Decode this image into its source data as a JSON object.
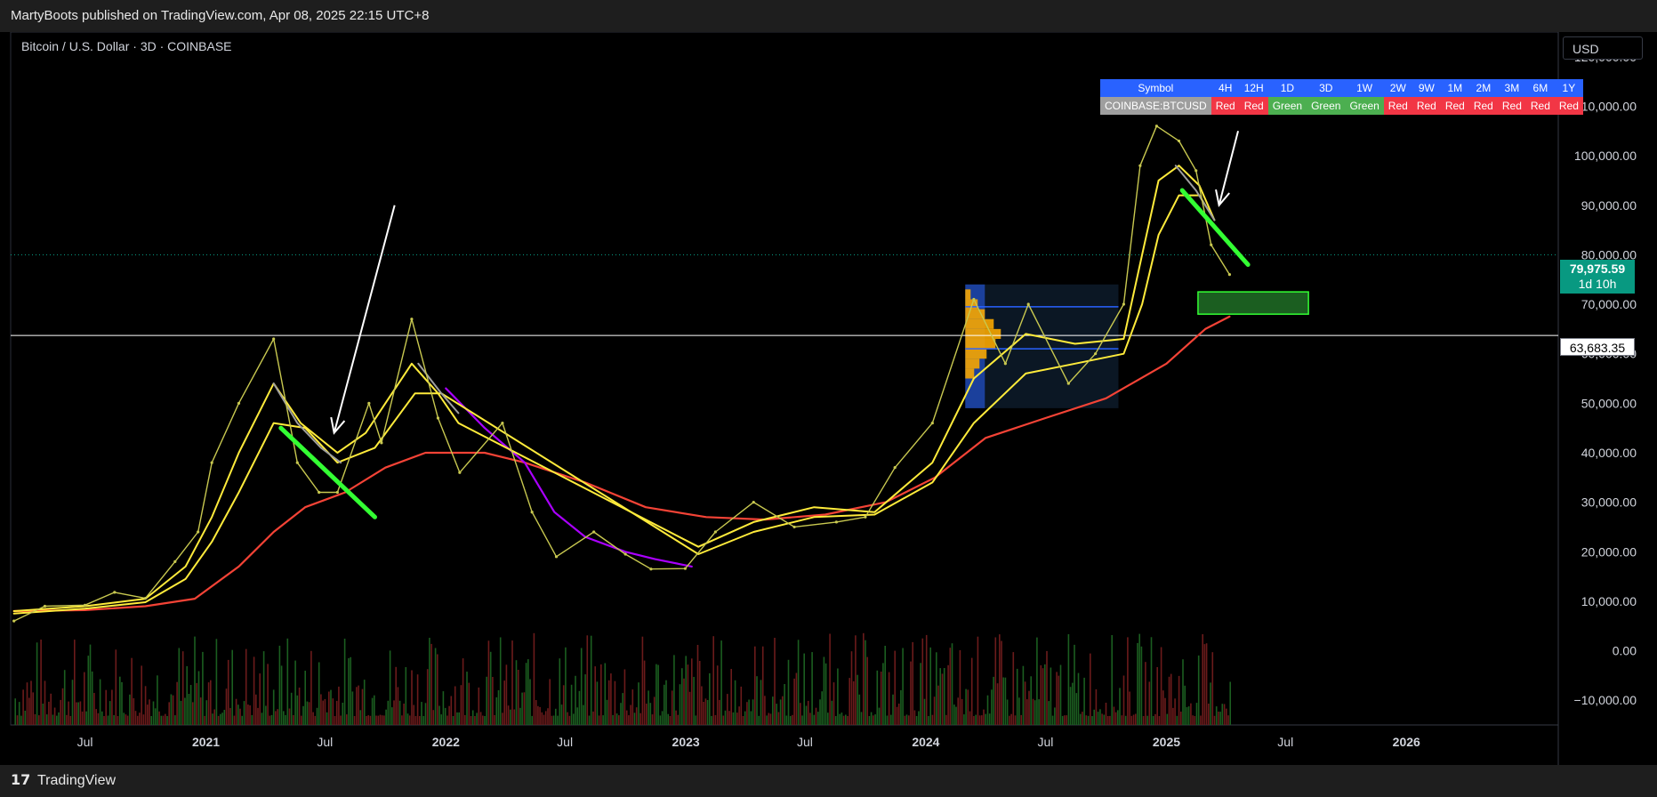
{
  "header": {
    "publish_line": "MartyBoots published on TradingView.com, Apr 08, 2025 22:15 UTC+8"
  },
  "symbol": {
    "title": "Bitcoin / U.S. Dollar · 3D · COINBASE"
  },
  "currency": {
    "label": "USD"
  },
  "footer": {
    "logo_glyph": "𝟭𝟳",
    "brand": "TradingView"
  },
  "signal_table": {
    "header": [
      "Symbol",
      "4H",
      "12H",
      "1D",
      "3D",
      "1W",
      "2W",
      "9W",
      "1M",
      "2M",
      "3M",
      "6M",
      "1Y"
    ],
    "row": [
      "COINBASE:BTCUSD",
      "Red",
      "Red",
      "Green",
      "Green",
      "Green",
      "Red",
      "Red",
      "Red",
      "Red",
      "Red",
      "Red",
      "Red"
    ],
    "colors": {
      "header_bg": "#2962ff",
      "red": "#f23645",
      "green": "#4caf50",
      "symbol_bg": "#9e9e9e"
    }
  },
  "badges": {
    "last_price": "79,975.59",
    "countdown": "1d 10h",
    "level": "63,683.35"
  },
  "chart_data": {
    "type": "line",
    "title": "Bitcoin / U.S. Dollar · 3D · COINBASE",
    "ylim": [
      -15000,
      125000
    ],
    "yticks": [
      -10000,
      0,
      10000,
      20000,
      30000,
      40000,
      50000,
      60000,
      70000,
      80000,
      90000,
      100000,
      110000,
      120000
    ],
    "ytick_labels": [
      "−10,000.00",
      "0.00",
      "10,000.00",
      "20,000.00",
      "30,000.00",
      "40,000.00",
      "50,000.00",
      "60,000.00",
      "70,000.00",
      "80,000.00",
      "90,000.00",
      "100,000.00",
      "110,000.00",
      "120,000.00"
    ],
    "xlim": [
      "2020-03-10",
      "2026-08-20"
    ],
    "xticks": [
      {
        "date": "2020-07-01",
        "label": "Jul",
        "bold": false
      },
      {
        "date": "2021-01-01",
        "label": "2021",
        "bold": true
      },
      {
        "date": "2021-07-01",
        "label": "Jul",
        "bold": false
      },
      {
        "date": "2022-01-01",
        "label": "2022",
        "bold": true
      },
      {
        "date": "2022-07-01",
        "label": "Jul",
        "bold": false
      },
      {
        "date": "2023-01-01",
        "label": "2023",
        "bold": true
      },
      {
        "date": "2023-07-01",
        "label": "Jul",
        "bold": false
      },
      {
        "date": "2024-01-01",
        "label": "2024",
        "bold": true
      },
      {
        "date": "2024-07-01",
        "label": "Jul",
        "bold": false
      },
      {
        "date": "2025-01-01",
        "label": "2025",
        "bold": true
      },
      {
        "date": "2025-07-01",
        "label": "Jul",
        "bold": false
      },
      {
        "date": "2026-01-01",
        "label": "2026",
        "bold": true
      }
    ],
    "grid": false,
    "colors": {
      "price": "#c8c850",
      "ema_fast": "#ffeb3b",
      "ema_slow": "#ffeb3b",
      "ma_long": "#f44336",
      "bear_ma": "#aa00ff",
      "grey_ma": "#9e9e9e",
      "trendline": "#33ff33",
      "arrow": "#ffffff",
      "zone": "#1b5e20",
      "volume_up": "#1b5e20",
      "volume_down": "#6b1b1b"
    },
    "price": {
      "x": [
        "2020-03-15",
        "2020-05-01",
        "2020-07-01",
        "2020-08-15",
        "2020-10-01",
        "2020-11-15",
        "2020-12-20",
        "2021-01-10",
        "2021-02-20",
        "2021-04-14",
        "2021-05-20",
        "2021-06-22",
        "2021-07-20",
        "2021-09-06",
        "2021-09-25",
        "2021-11-10",
        "2021-12-20",
        "2022-01-22",
        "2022-03-28",
        "2022-05-12",
        "2022-06-18",
        "2022-08-14",
        "2022-10-01",
        "2022-11-09",
        "2022-12-31",
        "2023-02-15",
        "2023-04-14",
        "2023-06-15",
        "2023-08-18",
        "2023-10-01",
        "2023-11-15",
        "2024-01-11",
        "2024-03-14",
        "2024-05-01",
        "2024-06-05",
        "2024-08-05",
        "2024-09-15",
        "2024-10-28",
        "2024-11-22",
        "2024-12-17",
        "2025-01-20",
        "2025-02-15",
        "2025-03-10",
        "2025-04-07"
      ],
      "values": [
        6000,
        9000,
        9200,
        11800,
        10600,
        18000,
        24000,
        38000,
        50000,
        63000,
        38000,
        32000,
        32000,
        50000,
        42000,
        67000,
        47000,
        36000,
        46000,
        28000,
        19000,
        24000,
        19500,
        16500,
        16600,
        24000,
        30000,
        25000,
        26000,
        27000,
        37000,
        46000,
        71000,
        58000,
        70000,
        54000,
        60000,
        70000,
        98000,
        106000,
        103000,
        97000,
        82000,
        76000
      ]
    },
    "ema_fast": {
      "x": [
        "2020-03-15",
        "2020-07-01",
        "2020-10-01",
        "2020-12-01",
        "2021-01-10",
        "2021-02-20",
        "2021-04-14",
        "2021-05-25",
        "2021-07-20",
        "2021-09-01",
        "2021-11-10",
        "2021-12-20",
        "2022-01-20",
        "2023-01-20",
        "2023-04-14",
        "2023-07-15",
        "2023-10-15",
        "2024-01-11",
        "2024-03-14",
        "2024-06-01",
        "2024-08-15",
        "2024-10-28",
        "2024-11-25",
        "2024-12-20",
        "2025-01-20",
        "2025-02-20",
        "2025-03-15"
      ],
      "values": [
        8000,
        9000,
        10500,
        17000,
        27000,
        40000,
        54000,
        46000,
        40000,
        44000,
        58000,
        52000,
        46000,
        21000,
        26000,
        29000,
        28000,
        38000,
        55000,
        64000,
        62000,
        63000,
        80000,
        95000,
        98000,
        94000,
        87000
      ]
    },
    "ema_slow": {
      "x": [
        "2020-03-15",
        "2020-07-01",
        "2020-10-01",
        "2020-12-01",
        "2021-01-10",
        "2021-02-20",
        "2021-04-14",
        "2021-06-01",
        "2021-07-20",
        "2021-09-15",
        "2021-11-15",
        "2021-12-25",
        "2023-01-20",
        "2023-04-14",
        "2023-07-15",
        "2023-10-15",
        "2024-01-11",
        "2024-03-14",
        "2024-06-01",
        "2024-08-15",
        "2024-10-28",
        "2024-11-25",
        "2024-12-20",
        "2025-01-20",
        "2025-02-20",
        "2025-03-15"
      ],
      "values": [
        7500,
        8500,
        9800,
        14500,
        22000,
        32000,
        46000,
        45000,
        38000,
        41000,
        52000,
        52000,
        19500,
        24000,
        27000,
        27500,
        34000,
        46000,
        56000,
        58000,
        60000,
        70000,
        84000,
        92000,
        92000,
        87000
      ]
    },
    "ma_long": {
      "x": [
        "2020-03-15",
        "2020-07-01",
        "2020-10-01",
        "2020-12-15",
        "2021-02-20",
        "2021-04-14",
        "2021-06-01",
        "2021-08-01",
        "2021-10-01",
        "2021-12-01",
        "2022-03-01",
        "2022-05-01",
        "2022-08-01",
        "2022-11-01",
        "2023-02-01",
        "2023-05-01",
        "2023-08-01",
        "2023-11-01",
        "2024-01-15",
        "2024-04-01",
        "2024-07-01",
        "2024-10-01",
        "2025-01-01",
        "2025-03-01",
        "2025-04-07"
      ],
      "values": [
        8000,
        8200,
        9000,
        10500,
        17000,
        24000,
        29000,
        32000,
        37000,
        40000,
        40000,
        38000,
        34000,
        29000,
        27000,
        26500,
        27500,
        30000,
        35000,
        43000,
        47000,
        51000,
        58000,
        65000,
        67500
      ]
    },
    "bear_ma": {
      "x": [
        "2022-01-01",
        "2022-03-01",
        "2022-05-01",
        "2022-06-15",
        "2022-08-01",
        "2022-10-01",
        "2022-11-15",
        "2023-01-10"
      ],
      "values": [
        53000,
        45000,
        38000,
        28000,
        23000,
        20000,
        18500,
        17000
      ]
    },
    "grey_ma": [
      {
        "x": [
          "2021-04-14",
          "2021-05-20",
          "2021-06-25",
          "2021-07-25"
        ],
        "values": [
          54000,
          46000,
          41000,
          38000
        ]
      },
      {
        "x": [
          "2021-11-20",
          "2021-12-25",
          "2022-01-20"
        ],
        "values": [
          58000,
          52000,
          48000
        ]
      },
      {
        "x": [
          "2025-01-15",
          "2025-02-15",
          "2025-03-15"
        ],
        "values": [
          98000,
          93000,
          87000
        ]
      }
    ],
    "trendlines": [
      {
        "x": [
          "2021-04-25",
          "2021-09-15"
        ],
        "values": [
          45000,
          27000
        ]
      },
      {
        "x": [
          "2025-01-25",
          "2025-05-05"
        ],
        "values": [
          93000,
          78000
        ]
      }
    ],
    "arrows": [
      {
        "from": [
          "2021-10-15",
          90000
        ],
        "to": [
          "2021-07-15",
          44000
        ]
      },
      {
        "from": [
          "2025-04-20",
          105000
        ],
        "to": [
          "2025-03-22",
          90000
        ]
      }
    ],
    "demand_zone": {
      "x": [
        "2025-02-18",
        "2025-08-05"
      ],
      "y": [
        68000,
        72500
      ]
    },
    "horizontal_levels": [
      {
        "value": 79975.59,
        "style": "dotted",
        "color": "#089981"
      },
      {
        "value": 63683.35,
        "style": "solid",
        "color": "#ffffff"
      }
    ],
    "volume_profile": {
      "box": {
        "x": [
          "2024-03-01",
          "2024-10-20"
        ],
        "y": [
          49000,
          74000
        ]
      },
      "value_area": [
        61000,
        69500
      ],
      "poc": 63683.35,
      "rows": [
        {
          "price": 72000,
          "width": 0.15
        },
        {
          "price": 70000,
          "width": 0.35
        },
        {
          "price": 68000,
          "width": 0.55
        },
        {
          "price": 66000,
          "width": 0.8
        },
        {
          "price": 64000,
          "width": 1.0
        },
        {
          "price": 62000,
          "width": 0.85
        },
        {
          "price": 60000,
          "width": 0.6
        },
        {
          "price": 58000,
          "width": 0.4
        },
        {
          "price": 56000,
          "width": 0.25
        }
      ]
    },
    "volume_seed": 7
  }
}
